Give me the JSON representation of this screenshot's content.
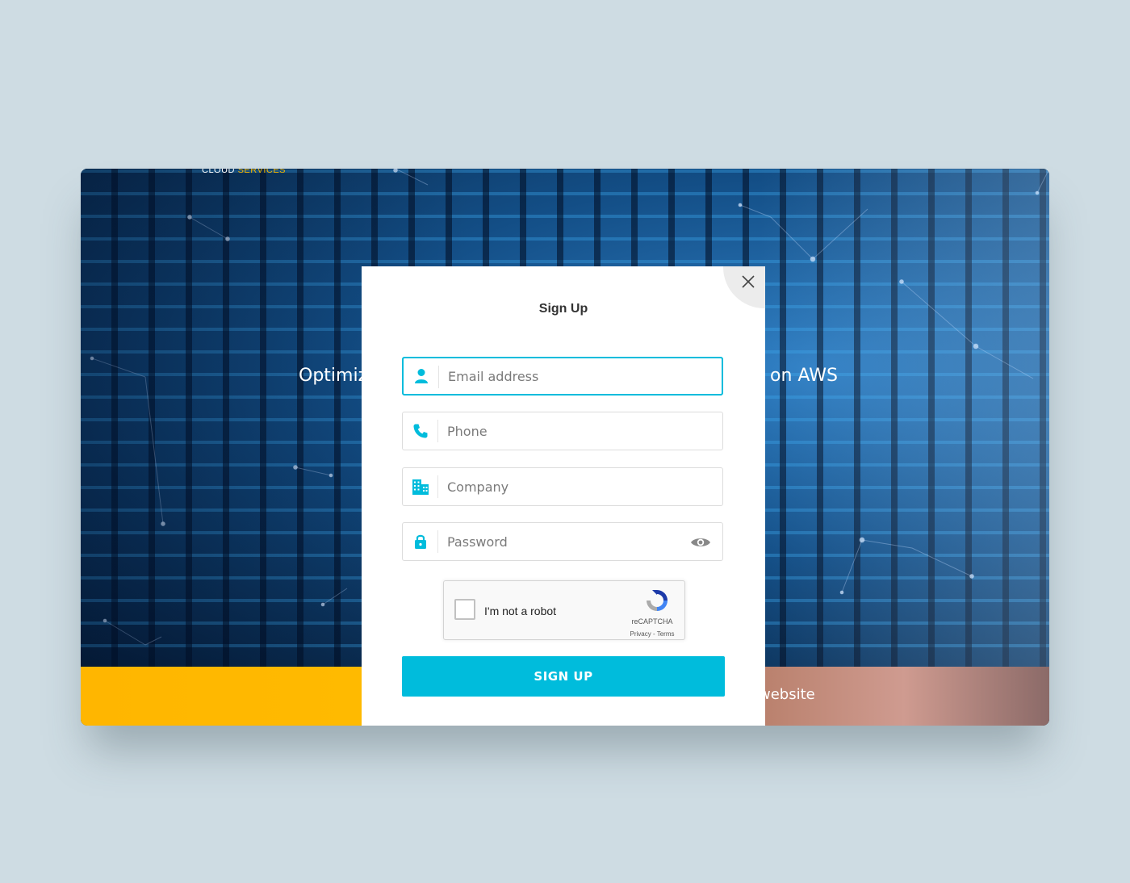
{
  "brand": {
    "text_main": "CLOUD ",
    "text_accent": "SERVICES"
  },
  "hero": {
    "headline_left": "Optimiz",
    "headline_right": "on AWS",
    "band_text": "website"
  },
  "modal": {
    "title": "Sign Up",
    "fields": {
      "email": {
        "placeholder": "Email address",
        "value": ""
      },
      "phone": {
        "placeholder": "Phone",
        "value": ""
      },
      "company": {
        "placeholder": "Company",
        "value": ""
      },
      "password": {
        "placeholder": "Password",
        "value": ""
      }
    },
    "captcha": {
      "label": "I'm not a robot",
      "brand": "reCAPTCHA",
      "links": "Privacy - Terms",
      "checked": false
    },
    "submit_label": "SIGN UP"
  },
  "colors": {
    "accent": "#00bcdc",
    "page_background": "#cedce3",
    "band_yellow": "#ffb600"
  },
  "icons": [
    "close-icon",
    "user-icon",
    "phone-icon",
    "building-icon",
    "lock-icon",
    "eye-icon",
    "recaptcha-icon"
  ]
}
